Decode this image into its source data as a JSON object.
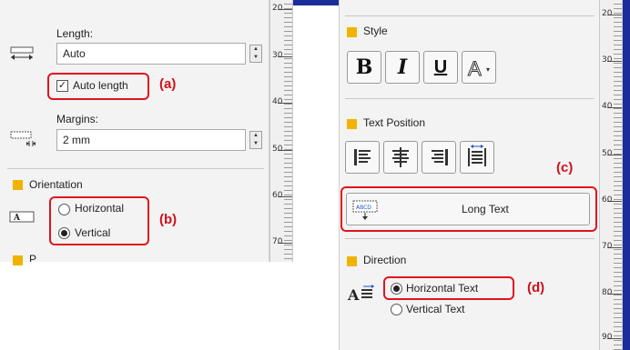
{
  "left_panel": {
    "length_label": "Length:",
    "length_value": "Auto",
    "auto_length_label": "Auto length",
    "auto_length_checked": true,
    "margins_label": "Margins:",
    "margins_value": "2 mm",
    "orientation_title": "Orientation",
    "horizontal_label": "Horizontal",
    "vertical_label": "Vertical",
    "selected_orientation": "Vertical",
    "next_section_partial": "P",
    "ruler_labels": [
      "20",
      "30",
      "40",
      "50",
      "60",
      "70"
    ]
  },
  "right_panel": {
    "style_title": "Style",
    "bold_label": "B",
    "italic_label": "I",
    "underline_label": "U",
    "outline_label": "A",
    "text_position_title": "Text Position",
    "long_text_label": "Long Text",
    "long_text_icon_text": "ABCD",
    "direction_title": "Direction",
    "direction_icon_letter": "A",
    "horizontal_text_label": "Horizontal Text",
    "vertical_text_label": "Vertical Text",
    "selected_direction": "Horizontal Text",
    "ruler_labels": [
      "20",
      "30",
      "40",
      "50",
      "60",
      "70",
      "80",
      "90"
    ]
  },
  "callouts": {
    "a": "(a)",
    "b": "(b)",
    "c": "(c)",
    "d": "(d)"
  },
  "colors": {
    "callout_red": "#e0141e",
    "section_marker": "#f0b400",
    "frame_blue": "#1a2d9a"
  },
  "icons": {
    "length": "length-arrow-icon",
    "margins": "margins-icon",
    "orientation": "orientation-icon",
    "align_left": "align-left-icon",
    "align_center": "align-center-icon",
    "align_right": "align-right-icon",
    "justify": "justify-icon",
    "long_text": "long-text-icon",
    "direction": "text-direction-icon"
  }
}
